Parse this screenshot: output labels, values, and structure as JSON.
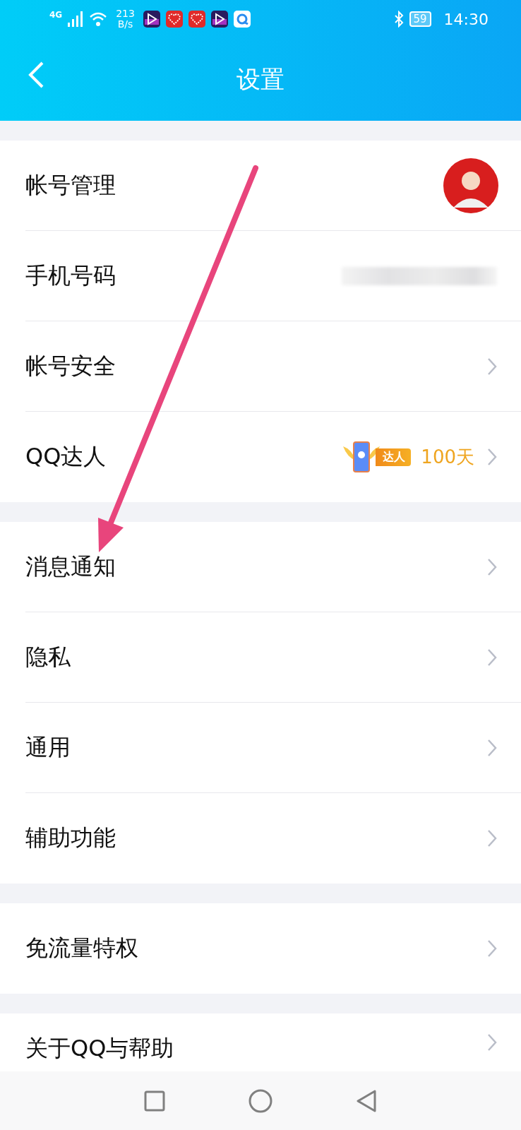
{
  "status_bar": {
    "network": "4G",
    "speed_value": "213",
    "speed_unit": "B/s",
    "notifications": [
      {
        "kind": "play"
      },
      {
        "kind": "heart"
      },
      {
        "kind": "heart"
      },
      {
        "kind": "play"
      },
      {
        "kind": "cloud"
      }
    ],
    "battery": "59",
    "time": "14:30"
  },
  "header": {
    "title": "设置"
  },
  "groups": [
    {
      "items": [
        {
          "label": "帐号管理",
          "kind": "avatar"
        },
        {
          "label": "手机号码",
          "kind": "redacted"
        },
        {
          "label": "帐号安全",
          "kind": "chevron"
        },
        {
          "label": "QQ达人",
          "kind": "badge",
          "badge_text": "达人",
          "value": "100天"
        }
      ]
    },
    {
      "items": [
        {
          "label": "消息通知",
          "kind": "chevron"
        },
        {
          "label": "隐私",
          "kind": "chevron"
        },
        {
          "label": "通用",
          "kind": "chevron"
        },
        {
          "label": "辅助功能",
          "kind": "chevron"
        }
      ]
    },
    {
      "items": [
        {
          "label": "免流量特权",
          "kind": "chevron"
        }
      ]
    },
    {
      "items": [
        {
          "label": "关于QQ与帮助",
          "kind": "chevron"
        }
      ]
    }
  ],
  "annotation_arrow": true
}
